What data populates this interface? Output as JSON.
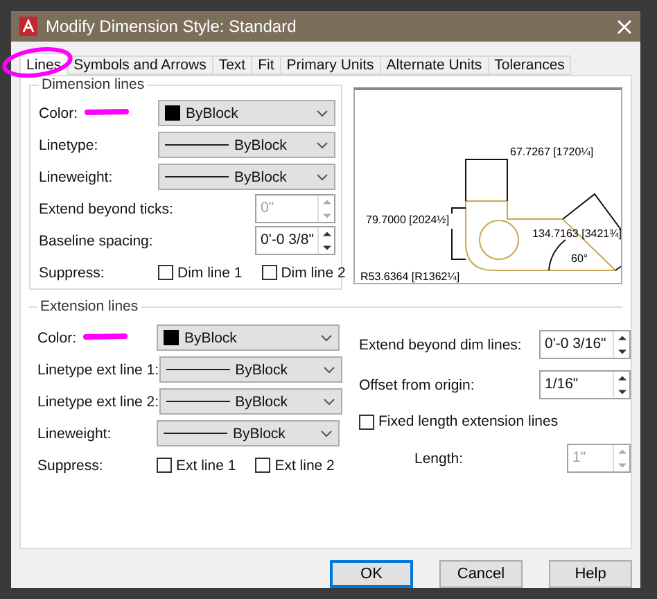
{
  "window": {
    "title": "Modify Dimension Style: Standard"
  },
  "tabs": [
    {
      "label": "Lines",
      "selected": true
    },
    {
      "label": "Symbols and Arrows",
      "selected": false
    },
    {
      "label": "Text",
      "selected": false
    },
    {
      "label": "Fit",
      "selected": false
    },
    {
      "label": "Primary Units",
      "selected": false
    },
    {
      "label": "Alternate Units",
      "selected": false
    },
    {
      "label": "Tolerances",
      "selected": false
    }
  ],
  "dimension_lines": {
    "legend": "Dimension lines",
    "rows": [
      {
        "kind": "color",
        "label": "Color:",
        "value": "ByBlock"
      },
      {
        "kind": "line",
        "label": "Linetype:",
        "value": "ByBlock"
      },
      {
        "kind": "line",
        "label": "Lineweight:",
        "value": "ByBlock"
      },
      {
        "kind": "spinner",
        "label": "Extend beyond ticks:",
        "value": "0\"",
        "disabled": true
      },
      {
        "kind": "spinner",
        "label": "Baseline spacing:",
        "value": "0'-0 3/8\"",
        "disabled": false
      },
      {
        "kind": "suppress",
        "label": "Suppress:",
        "options": [
          {
            "label": "Dim line 1",
            "checked": false
          },
          {
            "label": "Dim line 2",
            "checked": false
          }
        ]
      }
    ]
  },
  "preview": {
    "labels": [
      "67.7267 [1720¼]",
      "79.7000 [2024½]",
      "134.7163 [3421¾]",
      "R53.6364 [R1362¼]",
      "60°"
    ]
  },
  "extension_lines": {
    "legend": "Extension lines",
    "rows": [
      {
        "kind": "color",
        "label": "Color:",
        "value": "ByBlock"
      },
      {
        "kind": "line",
        "label": "Linetype ext line 1:",
        "value": "ByBlock"
      },
      {
        "kind": "line",
        "label": "Linetype ext line 2:",
        "value": "ByBlock"
      },
      {
        "kind": "line",
        "label": "Lineweight:",
        "value": "ByBlock"
      },
      {
        "kind": "suppress",
        "label": "Suppress:",
        "options": [
          {
            "label": "Ext line 1",
            "checked": false
          },
          {
            "label": "Ext line 2",
            "checked": false
          }
        ]
      }
    ],
    "right_rows": [
      {
        "kind": "spinner",
        "label": "Extend beyond dim lines:",
        "value": "0'-0 3/16\"",
        "disabled": false
      },
      {
        "kind": "spinner",
        "label": "Offset from origin:",
        "value": "1/16\"",
        "disabled": false
      },
      {
        "kind": "checkbox",
        "label": "Fixed length extension lines",
        "checked": false
      },
      {
        "kind": "spinner",
        "label": "Length:",
        "value": "1\"",
        "disabled": true
      }
    ]
  },
  "buttons": [
    {
      "label": "OK",
      "default": true
    },
    {
      "label": "Cancel",
      "default": false
    },
    {
      "label": "Help",
      "default": false
    }
  ]
}
